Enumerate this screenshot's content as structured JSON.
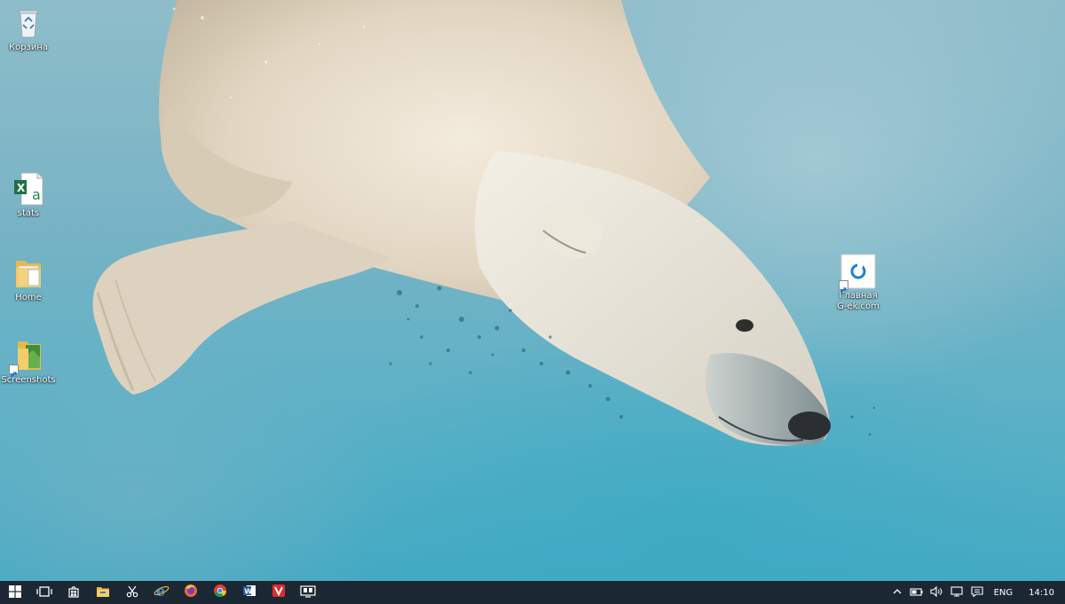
{
  "desktop": {
    "icons": [
      {
        "name": "recycle-bin",
        "label": "Корзина",
        "icon": "recycle-bin-icon"
      },
      {
        "name": "stats",
        "label": "stats",
        "icon": "excel-file-icon"
      },
      {
        "name": "home-folder",
        "label": "Home",
        "icon": "folder-icon"
      },
      {
        "name": "screenshots-folder",
        "label": "Screenshots",
        "icon": "folder-shortcut-icon"
      },
      {
        "name": "g-ek-shortcut",
        "label": "Главная\nG-ek.com",
        "icon": "web-shortcut-icon"
      }
    ]
  },
  "taskbar": {
    "buttons": [
      {
        "name": "start",
        "icon": "windows-logo-icon"
      },
      {
        "name": "task-view",
        "icon": "task-view-icon"
      },
      {
        "name": "store",
        "icon": "store-bag-icon"
      },
      {
        "name": "file-explorer",
        "icon": "folder-icon"
      },
      {
        "name": "scissors-app",
        "icon": "scissors-icon"
      },
      {
        "name": "internet-explorer",
        "icon": "ie-icon"
      },
      {
        "name": "firefox",
        "icon": "firefox-icon"
      },
      {
        "name": "chrome",
        "icon": "chrome-icon"
      },
      {
        "name": "word",
        "icon": "word-icon"
      },
      {
        "name": "vivaldi",
        "icon": "vivaldi-icon"
      },
      {
        "name": "remote-desktop",
        "icon": "monitor-icon"
      }
    ],
    "tray": {
      "language": "ENG",
      "time": "14:10"
    }
  }
}
